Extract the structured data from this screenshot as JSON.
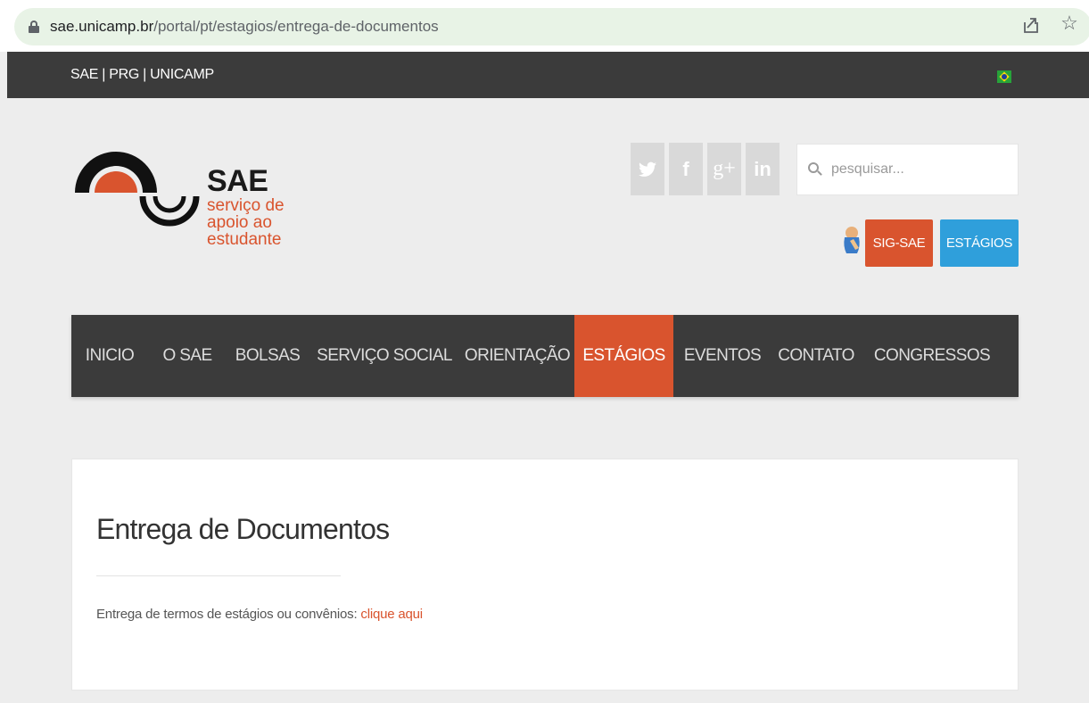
{
  "browser": {
    "url_host": "sae.unicamp.br",
    "url_path": "/portal/pt/estagios/entrega-de-documentos"
  },
  "topbar": {
    "links_text": "SAE | PRG | UNICAMP",
    "flag": "brazil-flag-icon"
  },
  "logo": {
    "title": "SAE",
    "subtitle_lines": [
      "serviço de",
      "apoio ao",
      "estudante"
    ],
    "accent_color": "#d9542e"
  },
  "social": [
    {
      "name": "twitter",
      "glyph": "🐦"
    },
    {
      "name": "facebook",
      "glyph": "f"
    },
    {
      "name": "google-plus",
      "glyph": "g+"
    },
    {
      "name": "linkedin",
      "glyph": "in"
    }
  ],
  "search": {
    "placeholder": "pesquisar..."
  },
  "buttons": {
    "sig_sae": "SIG-SAE",
    "estagios": "ESTÁGIOS"
  },
  "nav": {
    "items": [
      {
        "label": "INICIO",
        "active": false
      },
      {
        "label": "O SAE",
        "active": false
      },
      {
        "label": "BOLSAS",
        "active": false
      },
      {
        "label": "SERVIÇO SOCIAL",
        "active": false
      },
      {
        "label": "ORIENTAÇÃO",
        "active": false
      },
      {
        "label": "ESTÁGIOS",
        "active": true
      },
      {
        "label": "EVENTOS",
        "active": false
      },
      {
        "label": "CONTATO",
        "active": false
      },
      {
        "label": "CONGRESSOS",
        "active": false
      }
    ]
  },
  "content": {
    "title": "Entrega de Documentos",
    "text": "Entrega de termos de estágios ou convênios: ",
    "link_text": "clique aqui"
  },
  "colors": {
    "brand_orange": "#d9542e",
    "brand_blue": "#2f9fdb",
    "dark_bar": "#3b3b3b"
  }
}
